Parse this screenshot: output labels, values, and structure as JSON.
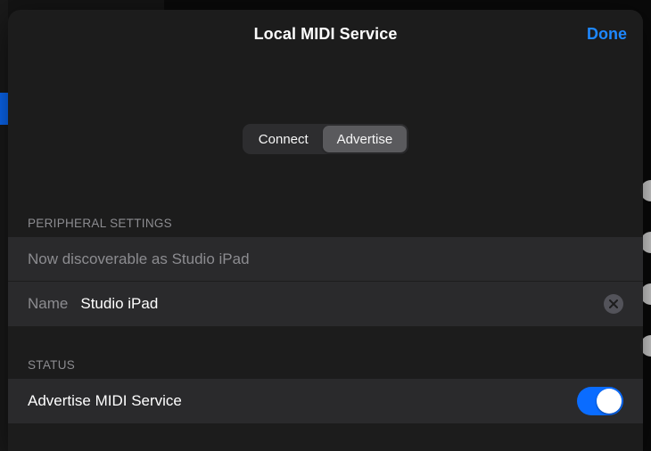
{
  "header": {
    "title": "Local MIDI Service",
    "done": "Done"
  },
  "segmented": {
    "connect": "Connect",
    "advertise": "Advertise",
    "active": "advertise"
  },
  "peripheral": {
    "section_label": "PERIPHERAL SETTINGS",
    "discoverable_text": "Now discoverable as Studio iPad",
    "name_label": "Name",
    "name_value": "Studio iPad"
  },
  "status": {
    "section_label": "STATUS",
    "toggle_label": "Advertise MIDI Service",
    "toggle_on": true
  },
  "colors": {
    "accent": "#0a6cff",
    "link": "#1e88ff"
  }
}
